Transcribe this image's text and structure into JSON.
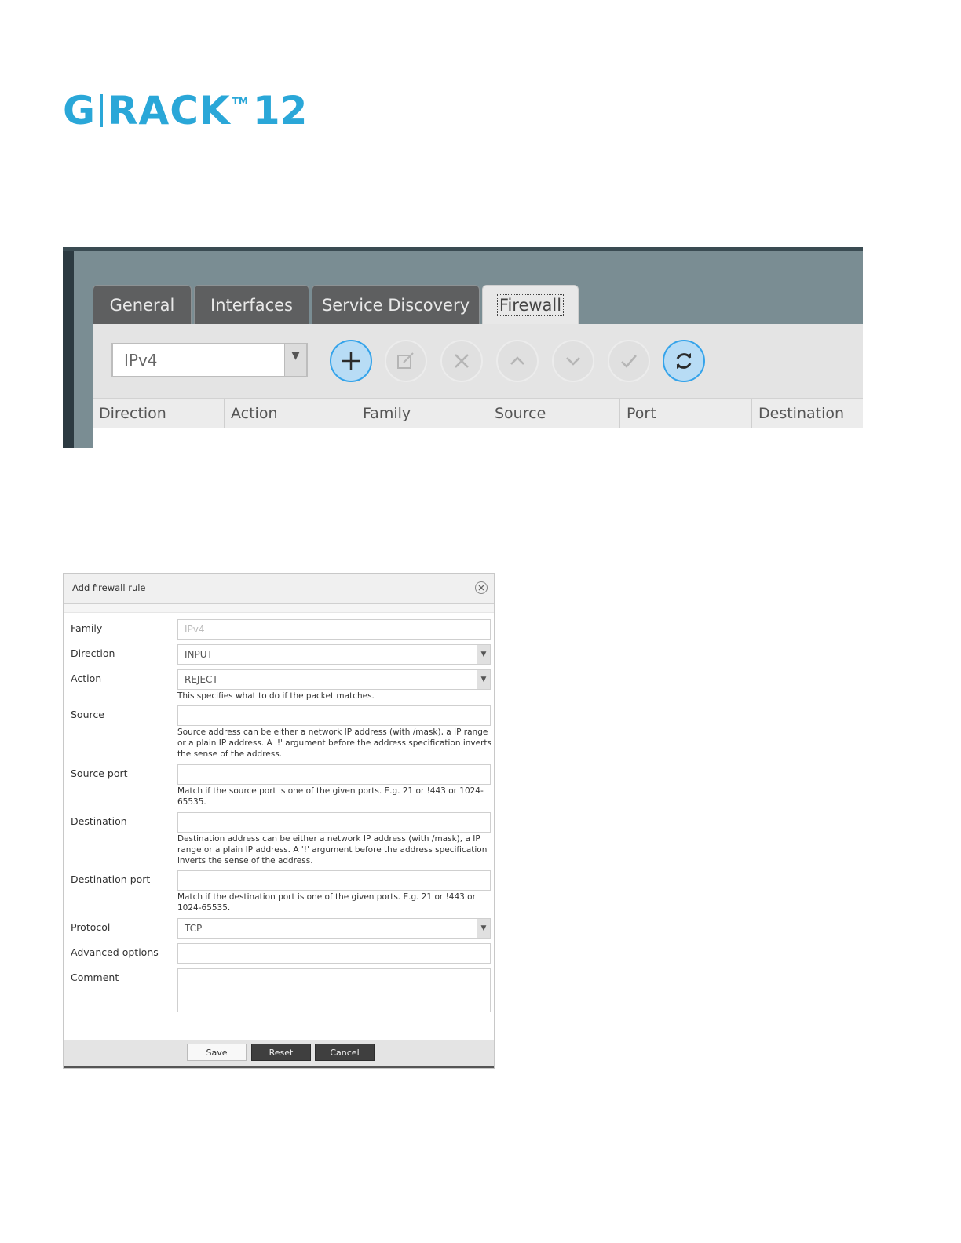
{
  "logo": {
    "g": "G",
    "rack": "RACK",
    "tm": "TM",
    "num": "12"
  },
  "screenshot1": {
    "tabs": [
      "General",
      "Interfaces",
      "Service Discovery",
      "Firewall"
    ],
    "active_tab": "Firewall",
    "family_select": "IPv4",
    "toolbar_buttons": [
      "add-icon",
      "edit-icon",
      "delete-icon",
      "move-up-icon",
      "move-down-icon",
      "apply-icon",
      "refresh-icon"
    ],
    "columns": [
      "Direction",
      "Action",
      "Family",
      "Source",
      "Port",
      "Destination"
    ]
  },
  "dialog": {
    "title": "Add firewall rule",
    "fields": {
      "family": {
        "label": "Family",
        "value": "IPv4"
      },
      "direction": {
        "label": "Direction",
        "value": "INPUT"
      },
      "action": {
        "label": "Action",
        "value": "REJECT",
        "help": "This specifies what to do if the packet matches."
      },
      "source": {
        "label": "Source",
        "value": "",
        "help": "Source address can be either a network IP address (with /mask), a IP range or a plain IP address. A '!' argument before the address specification inverts the sense of the address."
      },
      "source_port": {
        "label": "Source port",
        "value": "",
        "help": "Match if the source port is one of the given ports. E.g. 21 or !443 or 1024-65535."
      },
      "destination": {
        "label": "Destination",
        "value": "",
        "help": "Destination address can be either a network IP address (with /mask), a IP range or a plain IP address. A '!' argument before the address specification inverts the sense of the address."
      },
      "destination_port": {
        "label": "Destination port",
        "value": "",
        "help": "Match if the destination port is one of the given ports. E.g. 21 or !443 or 1024-65535."
      },
      "protocol": {
        "label": "Protocol",
        "value": "TCP"
      },
      "advanced": {
        "label": "Advanced options",
        "value": ""
      },
      "comment": {
        "label": "Comment",
        "value": ""
      }
    },
    "buttons": {
      "save": "Save",
      "reset": "Reset",
      "cancel": "Cancel"
    }
  },
  "colors": {
    "brand": "#2aa7d8",
    "accent_blue": "#34a3ea",
    "dark_button": "#3f3f3f"
  }
}
